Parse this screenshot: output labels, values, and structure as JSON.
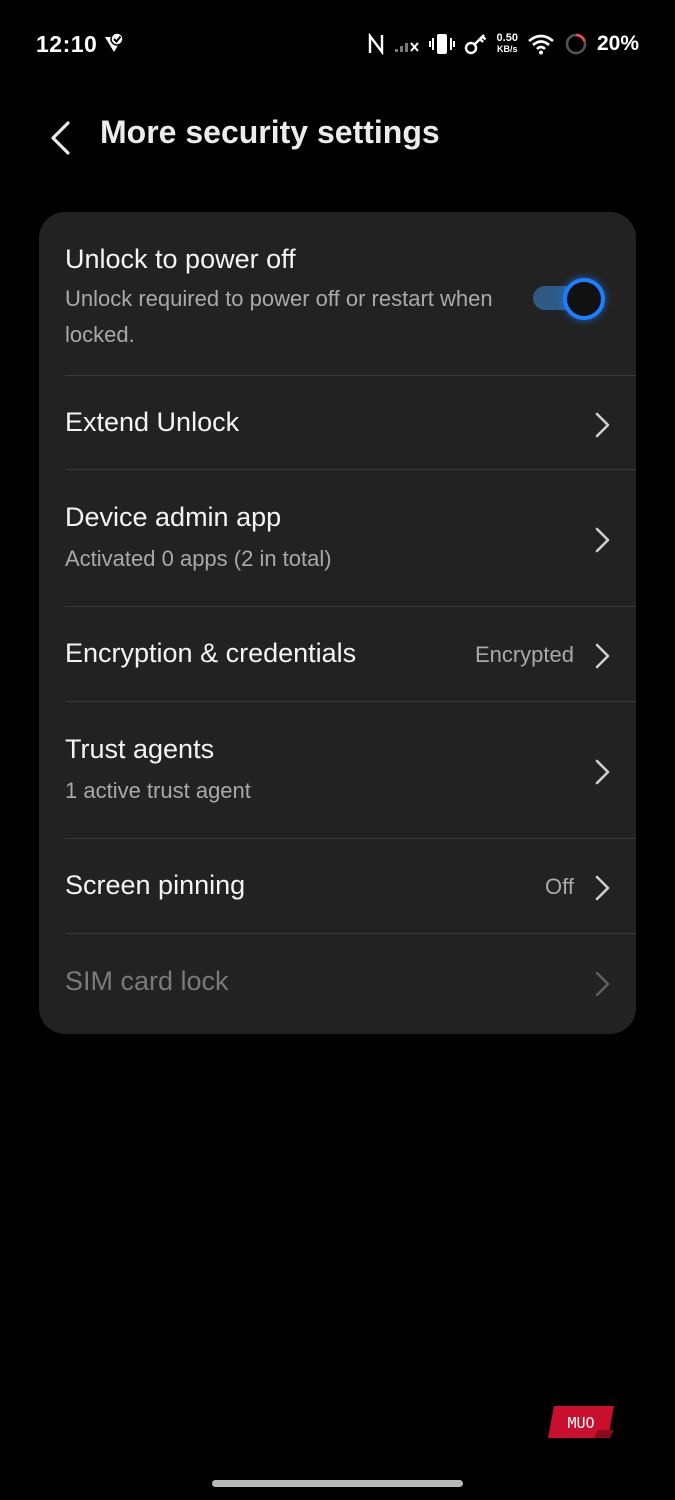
{
  "status_bar": {
    "time": "12:10",
    "speed_value": "0.50",
    "speed_unit": "KB/s",
    "battery": "20%"
  },
  "header": {
    "title": "More security settings"
  },
  "settings": {
    "unlock_power_off": {
      "title": "Unlock to power off",
      "subtitle": "Unlock required to power off or restart when locked.",
      "enabled": true
    },
    "extend_unlock": {
      "title": "Extend Unlock"
    },
    "device_admin": {
      "title": "Device admin app",
      "subtitle": "Activated 0 apps (2 in total)"
    },
    "encryption": {
      "title": "Encryption & credentials",
      "value": "Encrypted"
    },
    "trust_agents": {
      "title": "Trust agents",
      "subtitle": "1 active trust agent"
    },
    "screen_pinning": {
      "title": "Screen pinning",
      "value": "Off"
    },
    "sim_lock": {
      "title": "SIM card lock",
      "disabled": true
    }
  },
  "watermark": {
    "text": "MUO"
  },
  "colors": {
    "background": "#000000",
    "card": "#222222",
    "accent": "#1b7fff",
    "subtext": "#a9a9a9"
  }
}
